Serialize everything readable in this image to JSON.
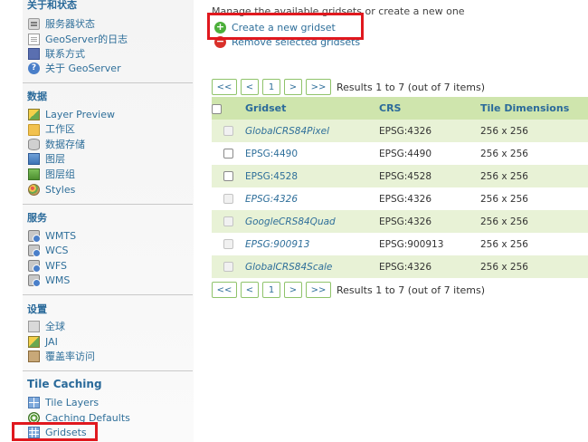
{
  "sidebar": {
    "sections": [
      {
        "title": "关于和状态",
        "items": [
          {
            "label": "服务器状态",
            "icon": "server-icon"
          },
          {
            "label": "GeoServer的日志",
            "icon": "page-icon"
          },
          {
            "label": "联系方式",
            "icon": "contact-icon"
          },
          {
            "label": "关于 GeoServer",
            "icon": "help-icon"
          }
        ]
      },
      {
        "title": "数据",
        "items": [
          {
            "label": "Layer Preview",
            "icon": "layer-preview-icon"
          },
          {
            "label": "工作区",
            "icon": "folder-icon"
          },
          {
            "label": "数据存储",
            "icon": "database-icon"
          },
          {
            "label": "图层",
            "icon": "layer-icon"
          },
          {
            "label": "图层组",
            "icon": "layer-group-icon"
          },
          {
            "label": "Styles",
            "icon": "styles-icon"
          }
        ]
      },
      {
        "title": "服务",
        "items": [
          {
            "label": "WMTS",
            "icon": "service-icon"
          },
          {
            "label": "WCS",
            "icon": "service-icon"
          },
          {
            "label": "WFS",
            "icon": "service-icon"
          },
          {
            "label": "WMS",
            "icon": "service-icon"
          }
        ]
      },
      {
        "title": "设置",
        "items": [
          {
            "label": "全球",
            "icon": "global-settings-icon"
          },
          {
            "label": "JAI",
            "icon": "jai-icon"
          },
          {
            "label": "覆盖率访问",
            "icon": "coverage-icon"
          }
        ]
      },
      {
        "title": "Tile Caching",
        "items": [
          {
            "label": "Tile Layers",
            "icon": "tile-layers-icon"
          },
          {
            "label": "Caching Defaults",
            "icon": "caching-defaults-icon"
          },
          {
            "label": "Gridsets",
            "icon": "gridsets-icon"
          }
        ]
      }
    ]
  },
  "main": {
    "intro": "Manage the available gridsets or create a new one",
    "create_label": "Create a new gridset",
    "remove_label": "Remove selected gridsets",
    "pager": {
      "first": "<<",
      "prev": "<",
      "page": "1",
      "next": ">",
      "last": ">>",
      "results_text": "Results 1 to 7 (out of 7 items)"
    },
    "table": {
      "headers": [
        "Gridset",
        "CRS",
        "Tile Dimensions"
      ],
      "rows": [
        {
          "name": "GlobalCRS84Pixel",
          "italic": true,
          "crs": "EPSG:4326",
          "dims": "256 x 256",
          "checkbox_enabled": false
        },
        {
          "name": "EPSG:4490",
          "italic": false,
          "crs": "EPSG:4490",
          "dims": "256 x 256",
          "checkbox_enabled": true
        },
        {
          "name": "EPSG:4528",
          "italic": false,
          "crs": "EPSG:4528",
          "dims": "256 x 256",
          "checkbox_enabled": true
        },
        {
          "name": "EPSG:4326",
          "italic": true,
          "crs": "EPSG:4326",
          "dims": "256 x 256",
          "checkbox_enabled": false
        },
        {
          "name": "GoogleCRS84Quad",
          "italic": true,
          "crs": "EPSG:4326",
          "dims": "256 x 256",
          "checkbox_enabled": false
        },
        {
          "name": "EPSG:900913",
          "italic": true,
          "crs": "EPSG:900913",
          "dims": "256 x 256",
          "checkbox_enabled": false
        },
        {
          "name": "GlobalCRS84Scale",
          "italic": true,
          "crs": "EPSG:4326",
          "dims": "256 x 256",
          "checkbox_enabled": false
        }
      ]
    }
  },
  "colors": {
    "link": "#2f6f9a",
    "header_bg": "#cfe5ad",
    "row_alt_bg": "#e8f2d6",
    "highlight_border": "#e0181e",
    "add_icon": "#4caf3a",
    "remove_icon": "#d9302a"
  }
}
